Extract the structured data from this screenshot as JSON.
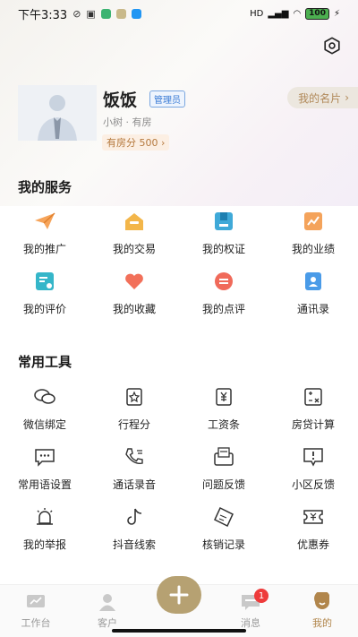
{
  "status_bar": {
    "time": "下午3:33",
    "network": "HD",
    "battery": "100"
  },
  "profile": {
    "name": "饭饭",
    "role": "管理员",
    "subtitle": "小树 · 有房",
    "points": "有房分 500",
    "card_button": "我的名片"
  },
  "services": {
    "title": "我的服务",
    "items": [
      {
        "label": "我的推广",
        "icon": "paper-plane-icon"
      },
      {
        "label": "我的交易",
        "icon": "house-transaction-icon"
      },
      {
        "label": "我的权证",
        "icon": "certificate-icon"
      },
      {
        "label": "我的业绩",
        "icon": "performance-chart-icon"
      },
      {
        "label": "我的评价",
        "icon": "rating-icon"
      },
      {
        "label": "我的收藏",
        "icon": "heart-icon"
      },
      {
        "label": "我的点评",
        "icon": "comment-icon"
      },
      {
        "label": "通讯录",
        "icon": "contacts-icon"
      }
    ]
  },
  "tools": {
    "title": "常用工具",
    "items": [
      {
        "label": "微信绑定",
        "icon": "wechat-icon"
      },
      {
        "label": "行程分",
        "icon": "itinerary-star-icon"
      },
      {
        "label": "工资条",
        "icon": "payslip-icon"
      },
      {
        "label": "房贷计算",
        "icon": "calculator-icon"
      },
      {
        "label": "常用语设置",
        "icon": "phrases-icon"
      },
      {
        "label": "通话录音",
        "icon": "call-recording-icon"
      },
      {
        "label": "问题反馈",
        "icon": "feedback-inbox-icon"
      },
      {
        "label": "小区反馈",
        "icon": "report-icon"
      },
      {
        "label": "我的举报",
        "icon": "alarm-icon"
      },
      {
        "label": "抖音线索",
        "icon": "douyin-icon"
      },
      {
        "label": "核销记录",
        "icon": "ticket-icon"
      },
      {
        "label": "优惠券",
        "icon": "coupon-icon"
      }
    ]
  },
  "tabbar": {
    "tabs": [
      {
        "label": "工作台",
        "icon": "workbench-icon"
      },
      {
        "label": "客户",
        "icon": "customer-icon"
      },
      {
        "label": "",
        "icon": "plus-icon"
      },
      {
        "label": "消息",
        "icon": "message-icon",
        "badge": "1"
      },
      {
        "label": "我的",
        "icon": "mine-icon"
      }
    ]
  },
  "colors": {
    "accent": "#b1864c",
    "badge_red": "#ee3b3b",
    "fab": "#b6a172"
  }
}
